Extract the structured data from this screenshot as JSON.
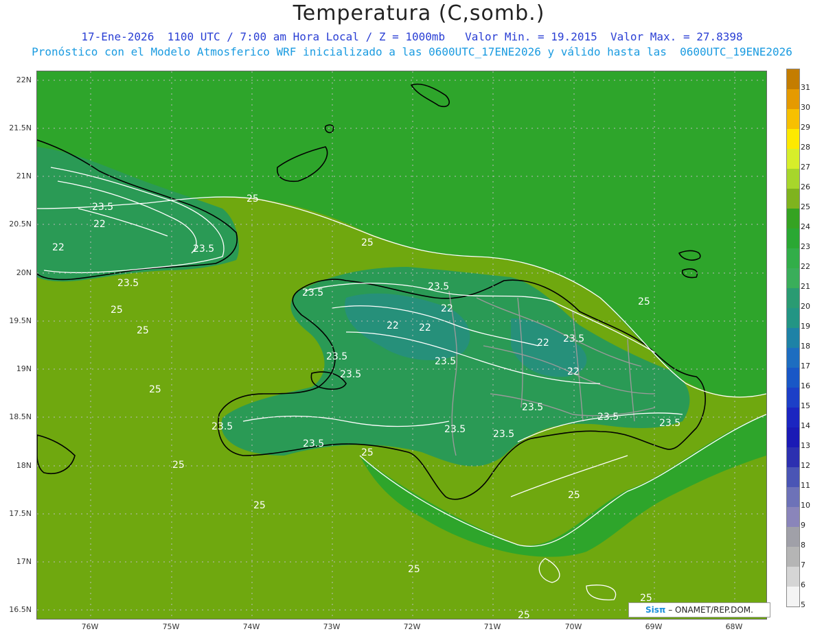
{
  "title": "Temperatura (C,somb.)",
  "subtitle1": "17-Ene-2026  1100 UTC / 7:00 am Hora Local / Z = 1000mb   Valor Min. = 19.2015  Valor Max. = 27.8398",
  "subtitle2": "Pronóstico con el Modelo Atmosferico WRF inicializado a las 0600UTC_17ENE2026 y válido hasta las  0600UTC_19ENE2026",
  "lat_labels": [
    "22N",
    "21.5N",
    "21N",
    "20.5N",
    "20N",
    "19.5N",
    "19N",
    "18.5N",
    "18N",
    "17.5N",
    "17N",
    "16.5N"
  ],
  "lon_labels": [
    "76W",
    "75W",
    "74W",
    "73W",
    "72W",
    "71W",
    "70W",
    "69W",
    "68W"
  ],
  "legend": {
    "levels": [
      "31",
      "30",
      "29",
      "28",
      "27",
      "26",
      "25",
      "24",
      "23",
      "22",
      "21",
      "20",
      "19",
      "18",
      "17",
      "16",
      "15",
      "14",
      "13",
      "12",
      "11",
      "10",
      "9",
      "8",
      "7",
      "6",
      "5"
    ],
    "colors": [
      "#c47d00",
      "#e59a00",
      "#f7c000",
      "#fde900",
      "#d7ee2a",
      "#a7d62b",
      "#7fb31e",
      "#35a322",
      "#2aa833",
      "#32ae49",
      "#3aae5a",
      "#2a9b72",
      "#239584",
      "#1e82a6",
      "#1d6dc0",
      "#1957c6",
      "#1c3fc7",
      "#1b25c0",
      "#1a1ab5",
      "#2c30b0",
      "#4a55b5",
      "#6d72b8",
      "#8a85ba",
      "#a0a0a8",
      "#b5b5b5",
      "#d5d5d5",
      "#f4f4f4"
    ]
  },
  "contour_labels": {
    "c25": "25",
    "c235": "23.5",
    "c22": "22"
  },
  "credit": {
    "logo": "Sisπ",
    "org": " – ONAMET/REP.DOM."
  },
  "colors": {
    "sea": "#6fa80f",
    "land_warm": "#2ea52b",
    "land_cool": "#229760",
    "coast": "#000000",
    "borders": "#9a9a9a",
    "contour": "#ffffff"
  }
}
